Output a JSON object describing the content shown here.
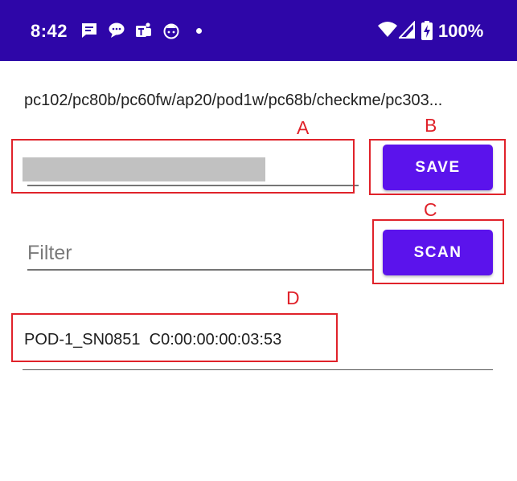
{
  "status_bar": {
    "time": "8:42",
    "battery_level": "100%",
    "notification_icons": [
      "message-icon",
      "chat-bubble-icon",
      "teams-icon",
      "app-face-icon"
    ],
    "system_icons": [
      "wifi-icon",
      "cell-signal-icon",
      "battery-charging-icon"
    ],
    "background_color": "#2e06a8"
  },
  "device_list_label": "pc102/pc80b/pc60fw/ap20/pod1w/pc68b/checkme/pc303...",
  "save_button": {
    "label": "SAVE"
  },
  "filter": {
    "placeholder": "Filter",
    "value": ""
  },
  "scan_button": {
    "label": "SCAN"
  },
  "results": [
    {
      "name": "POD-1_SN0851",
      "address": "C0:00:00:00:03:53"
    }
  ],
  "result_line": "POD-1_SN0851  C0:00:00:00:03:53",
  "annotations": {
    "a": "A",
    "b": "B",
    "c": "C",
    "d": "D"
  },
  "colors": {
    "button": "#5b13ec",
    "annotation": "#e0222a"
  }
}
